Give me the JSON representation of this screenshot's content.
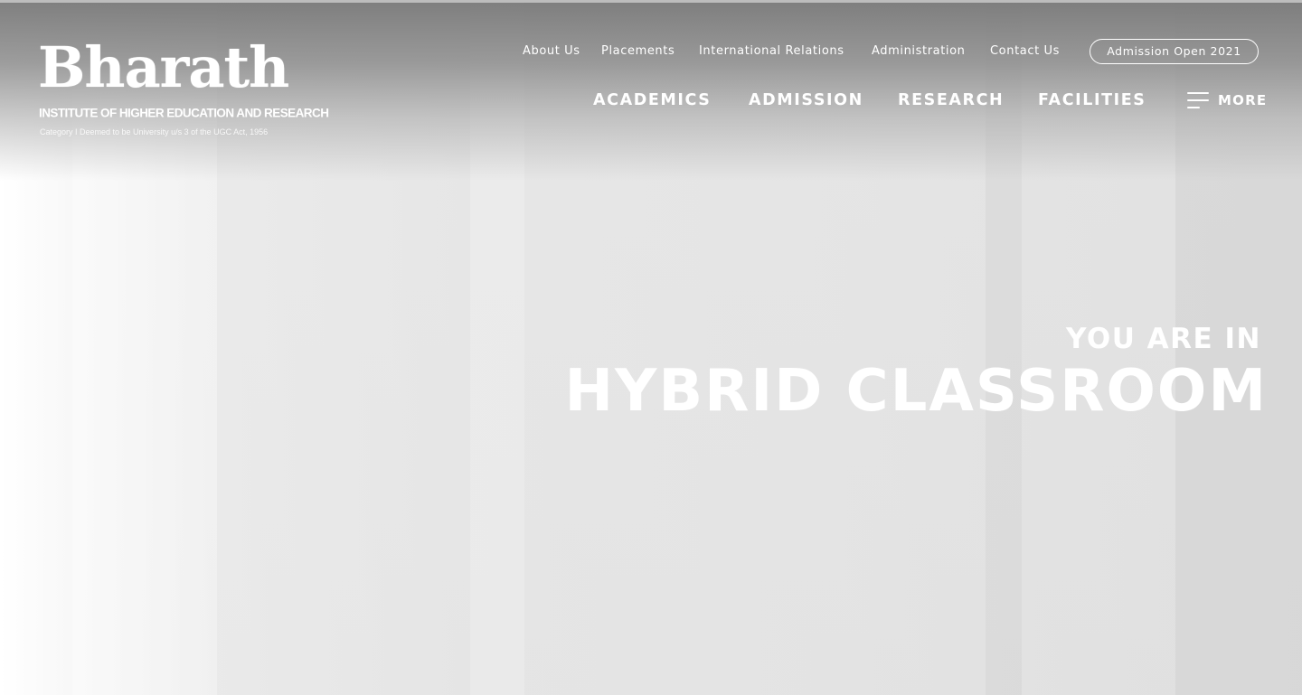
{
  "logo": {
    "wordmark": "Bharath",
    "subtitle": "INSTITUTE OF HIGHER EDUCATION AND RESEARCH",
    "tagline": "Category I Deemed to be University u/s 3 of the UGC Act, 1956"
  },
  "utility_nav": {
    "items": [
      {
        "label": "About Us"
      },
      {
        "label": "Placements"
      },
      {
        "label": "International Relations"
      },
      {
        "label": "Administration"
      },
      {
        "label": "Contact Us"
      }
    ],
    "admission_button": "Admission Open 2021"
  },
  "main_nav": {
    "items": [
      {
        "label": "ACADEMICS"
      },
      {
        "label": "ADMISSION"
      },
      {
        "label": "RESEARCH"
      },
      {
        "label": "FACILITIES"
      }
    ],
    "more_label": "MORE",
    "more_icon": "hamburger-menu-icon"
  },
  "hero": {
    "pre_title": "YOU ARE IN",
    "title": "HYBRID CLASSROOM"
  },
  "colors": {
    "nav_text": "#ffffff",
    "hero_text": "#ffffff",
    "header_shade": "#8a8a8a",
    "background": "#e4e4e4"
  }
}
